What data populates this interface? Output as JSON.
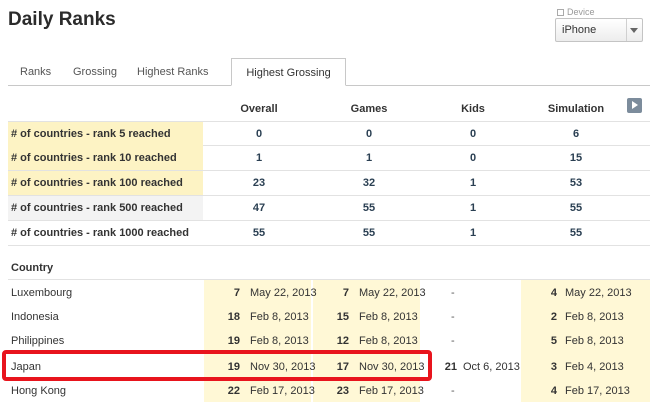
{
  "page": {
    "title": "Daily Ranks"
  },
  "device": {
    "label": "Device",
    "selected": "iPhone"
  },
  "tabs": [
    {
      "label": "Ranks",
      "active": false
    },
    {
      "label": "Grossing",
      "active": false
    },
    {
      "label": "Highest Ranks",
      "active": false
    },
    {
      "label": "Highest Grossing",
      "active": true
    }
  ],
  "columns": [
    "Overall",
    "Games",
    "Kids",
    "Simulation"
  ],
  "summary": [
    {
      "label": "# of countries - rank 5 reached",
      "values": [
        "0",
        "0",
        "0",
        "6"
      ]
    },
    {
      "label": "# of countries - rank 10 reached",
      "values": [
        "1",
        "1",
        "0",
        "15"
      ]
    },
    {
      "label": "# of countries - rank 100 reached",
      "values": [
        "23",
        "32",
        "1",
        "53"
      ]
    },
    {
      "label": "# of countries - rank 500 reached",
      "values": [
        "47",
        "55",
        "1",
        "55"
      ]
    },
    {
      "label": "# of countries - rank 1000 reached",
      "values": [
        "55",
        "55",
        "1",
        "55"
      ]
    }
  ],
  "country_header": "Country",
  "countries": [
    {
      "name": "Luxembourg",
      "overall_rank": "7",
      "overall_date": "May 22, 2013",
      "games_rank": "7",
      "games_date": "May 22, 2013",
      "kids_rank": "",
      "kids_date": "-",
      "sim_rank": "4",
      "sim_date": "May 22, 2013"
    },
    {
      "name": "Indonesia",
      "overall_rank": "18",
      "overall_date": "Feb 8, 2013",
      "games_rank": "15",
      "games_date": "Feb 8, 2013",
      "kids_rank": "",
      "kids_date": "-",
      "sim_rank": "2",
      "sim_date": "Feb 8, 2013"
    },
    {
      "name": "Philippines",
      "overall_rank": "19",
      "overall_date": "Feb 8, 2013",
      "games_rank": "12",
      "games_date": "Feb 8, 2013",
      "kids_rank": "",
      "kids_date": "-",
      "sim_rank": "5",
      "sim_date": "Feb 8, 2013"
    },
    {
      "name": "Japan",
      "overall_rank": "19",
      "overall_date": "Nov 30, 2013",
      "games_rank": "17",
      "games_date": "Nov 30, 2013",
      "kids_rank": "21",
      "kids_date": "Oct 6, 2013",
      "sim_rank": "3",
      "sim_date": "Feb 4, 2013"
    },
    {
      "name": "Hong Kong",
      "overall_rank": "22",
      "overall_date": "Feb 17, 2013",
      "games_rank": "23",
      "games_date": "Feb 17, 2013",
      "kids_rank": "",
      "kids_date": "-",
      "sim_rank": "4",
      "sim_date": "Feb 17, 2013"
    }
  ],
  "colors": {
    "highlight_border": "#e8141d",
    "label_highlight": "#fdf3c4",
    "column_highlight": "#fff8d6",
    "next_button": "#7c8c9c"
  }
}
